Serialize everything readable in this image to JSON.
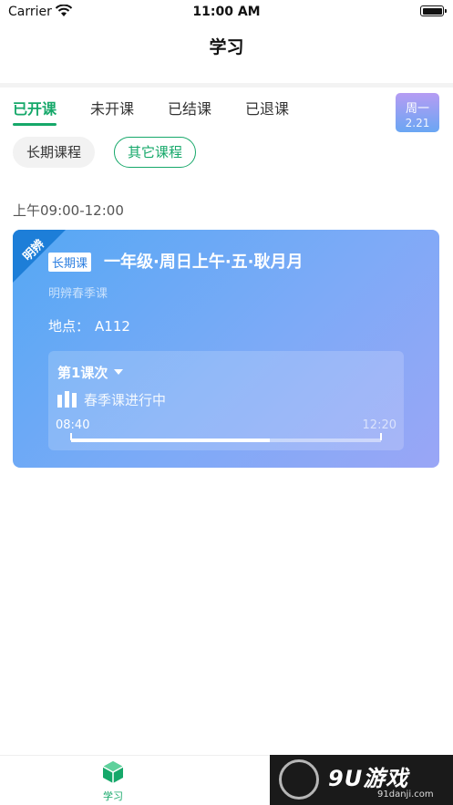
{
  "status_bar": {
    "carrier": "Carrier",
    "time": "11:00 AM"
  },
  "nav": {
    "title": "学习"
  },
  "tabs": [
    {
      "label": "已开课",
      "active": true
    },
    {
      "label": "未开课",
      "active": false
    },
    {
      "label": "已结课",
      "active": false
    },
    {
      "label": "已退课",
      "active": false
    }
  ],
  "date_badge": {
    "weekday": "周一",
    "day": "2.21"
  },
  "filters": [
    {
      "label": "长期课程",
      "selected": false
    },
    {
      "label": "其它课程",
      "selected": true
    }
  ],
  "time_slot": "上午09:00-12:00",
  "course": {
    "ribbon": "明辨",
    "tag": "长期课",
    "title": "一年级·周日上午·五·耿月月",
    "subtitle": "明辨春季课",
    "location_label": "地点：",
    "location_value": "A112",
    "session_label": "第1课次",
    "status": "春季课进行中",
    "start_time": "08:40",
    "end_time": "12:20",
    "progress": 0.64
  },
  "tabbar": {
    "study_label": "学习"
  },
  "watermark": {
    "brand": "9U游戏",
    "url": "91danji.com"
  },
  "colors": {
    "accent": "#16a86a",
    "card_start": "#55a8f4",
    "card_end": "#9aa6f6"
  }
}
